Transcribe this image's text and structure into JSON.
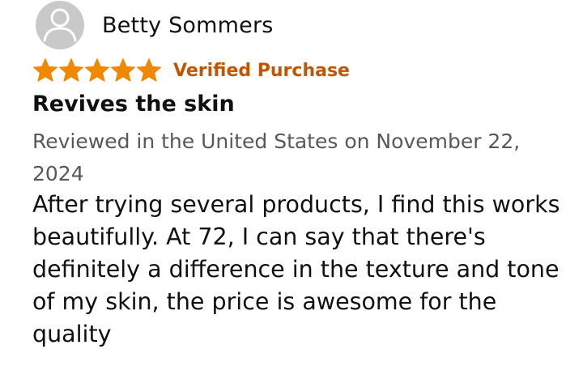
{
  "reviewer": {
    "name": "Betty Sommers",
    "avatar_icon": "default-user-avatar-icon"
  },
  "rating": {
    "stars": 5,
    "max_stars": 5,
    "star_color": "#f08804",
    "star_icon": "star-icon"
  },
  "badge": {
    "label": "Verified Purchase",
    "color": "#c45500"
  },
  "review": {
    "title": "Revives the skin",
    "meta": "Reviewed in the United States on November 22, 2024",
    "body": "After trying several products, I find this works beautifully. At 72, I can say that there's definitely a difference in the texture and tone of my skin, the price is awesome for the quality"
  },
  "colors": {
    "text_primary": "#0f1111",
    "text_secondary": "#565959",
    "avatar_bg": "#c9c9c9"
  }
}
